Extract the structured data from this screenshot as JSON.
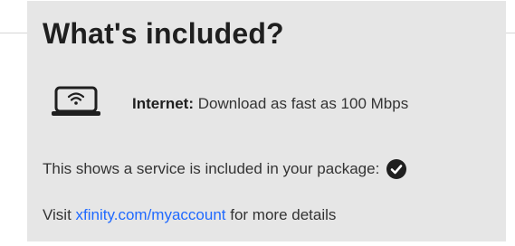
{
  "card": {
    "title": "What's included?",
    "feature": {
      "icon": "laptop-wifi-icon",
      "label": "Internet:",
      "description": "Download as fast as 100 Mbps"
    },
    "included_note": "This shows a service is included in your package:",
    "included_icon": "check-circle-icon",
    "visit": {
      "prefix": "Visit",
      "link_text": "xfinity.com/myaccount",
      "suffix": "for more details"
    }
  },
  "colors": {
    "card_background": "#e6e6e6",
    "link": "#1f69ff",
    "text": "#1f1f1f"
  }
}
